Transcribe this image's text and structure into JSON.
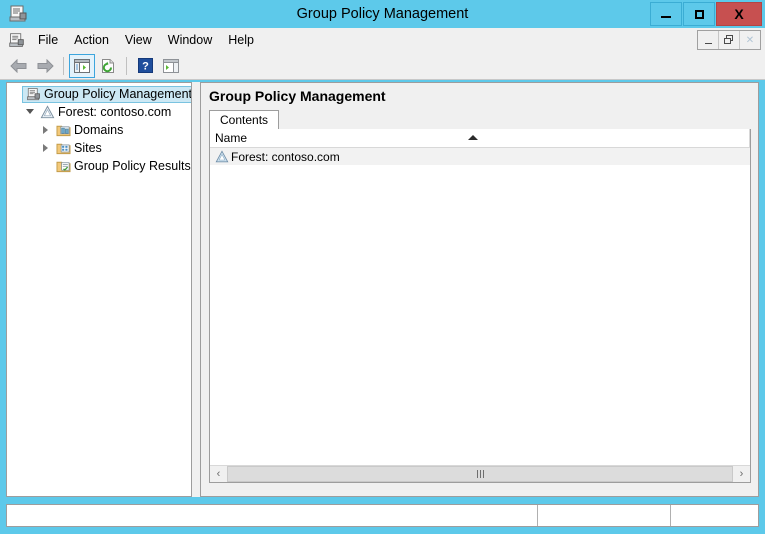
{
  "window": {
    "title": "Group Policy Management",
    "icon": "console-scroll-icon",
    "caption_buttons": [
      {
        "name": "minimize",
        "glyph": "minimize-icon"
      },
      {
        "name": "maximize",
        "glyph": "maximize-icon"
      },
      {
        "name": "close",
        "glyph": "X"
      }
    ],
    "accent_color": "#5dc9ea",
    "close_color": "#c75050"
  },
  "menubar": {
    "icon": "console-scroll-icon",
    "items": [
      {
        "label": "File"
      },
      {
        "label": "Action"
      },
      {
        "label": "View"
      },
      {
        "label": "Window"
      },
      {
        "label": "Help"
      }
    ],
    "mdi_buttons": [
      {
        "name": "mdi-minimize",
        "glyph": "_"
      },
      {
        "name": "mdi-restore",
        "glyph": "❐"
      },
      {
        "name": "mdi-close",
        "glyph": "✕"
      }
    ]
  },
  "toolbar": {
    "buttons": [
      {
        "name": "back-button",
        "icon": "left-arrow-icon",
        "active": false
      },
      {
        "name": "forward-button",
        "icon": "right-arrow-icon",
        "active": false
      },
      {
        "name": "show-hide-console-tree-button",
        "icon": "console-tree-icon",
        "active": true
      },
      {
        "name": "refresh-button",
        "icon": "refresh-page-icon",
        "active": false
      },
      {
        "name": "help-button",
        "icon": "question-mark-icon",
        "active": false
      },
      {
        "name": "show-hide-action-pane-button",
        "icon": "action-pane-icon",
        "active": false
      }
    ]
  },
  "tree": {
    "nodes": [
      {
        "label": "Group Policy Management",
        "icon": "console-scroll-icon",
        "indent": 0,
        "twisty": "none",
        "selected": true
      },
      {
        "label": "Forest: contoso.com",
        "icon": "forest-icon",
        "indent": 1,
        "twisty": "expanded",
        "selected": false
      },
      {
        "label": "Domains",
        "icon": "domains-folder-icon",
        "indent": 2,
        "twisty": "collapsed",
        "selected": false
      },
      {
        "label": "Sites",
        "icon": "sites-folder-icon",
        "indent": 2,
        "twisty": "collapsed",
        "selected": false
      },
      {
        "label": "Group Policy Results",
        "icon": "results-folder-icon",
        "indent": 2,
        "twisty": "none",
        "selected": false
      }
    ]
  },
  "content": {
    "title": "Group Policy Management",
    "tabs": [
      {
        "label": "Contents",
        "active": true
      }
    ],
    "listview": {
      "columns": [
        {
          "label": "Name",
          "sorted": "asc"
        }
      ],
      "rows": [
        {
          "name": "Forest: contoso.com",
          "icon": "forest-icon"
        }
      ]
    },
    "hscroll": {
      "left_glyph": "‹",
      "right_glyph": "›"
    }
  },
  "statusbar": {
    "panels": [
      {
        "text": ""
      },
      {
        "text": ""
      },
      {
        "text": ""
      }
    ]
  }
}
